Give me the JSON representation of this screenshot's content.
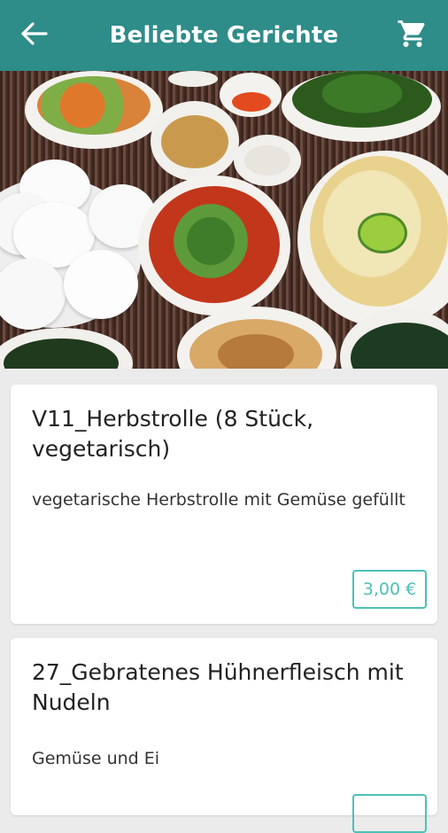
{
  "header": {
    "title": "Beliebte Gerichte",
    "back_icon": "arrow-left-icon",
    "cart_icon": "shopping-cart-icon",
    "background_color": "#2e8c89"
  },
  "hero": {
    "image": "food-spread-photo"
  },
  "dishes": [
    {
      "name": "V11_Herbstrolle (8 Stück, vegetarisch)",
      "description": "vegetarische Herbstrolle mit Gemüse gefüllt",
      "price": "3,00 €"
    },
    {
      "name": "27_Gebratenes Hühnerfleisch mit Nudeln",
      "description": "Gemüse und Ei",
      "price": ""
    }
  ],
  "colors": {
    "accent": "#4cc1b6",
    "background": "#ebebeb"
  }
}
